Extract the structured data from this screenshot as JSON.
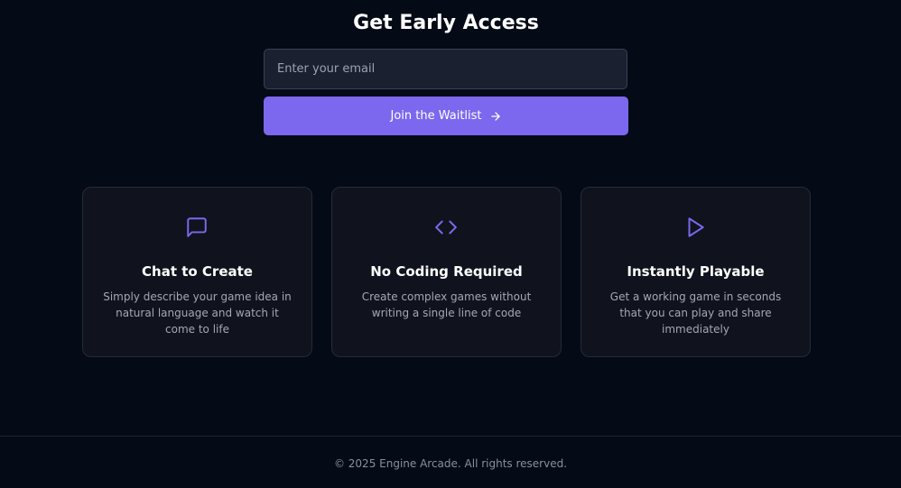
{
  "signup": {
    "title": "Get Early Access",
    "email_placeholder": "Enter your email",
    "email_value": "",
    "button_label": "Join the Waitlist",
    "button_icon": "arrow-right-icon"
  },
  "features": [
    {
      "icon": "message-square-icon",
      "title": "Chat to Create",
      "description": "Simply describe your game idea in natural language and watch it come to life"
    },
    {
      "icon": "code-icon",
      "title": "No Coding Required",
      "description": "Create complex games without writing a single line of code"
    },
    {
      "icon": "play-icon",
      "title": "Instantly Playable",
      "description": "Get a working game in seconds that you can play and share immediately"
    }
  ],
  "footer": {
    "copyright": "© 2025 Engine Arcade. All rights reserved."
  },
  "colors": {
    "background": "#050a17",
    "accent": "#7b68ee",
    "card_background": "#10131d",
    "input_background": "#1b2030"
  }
}
